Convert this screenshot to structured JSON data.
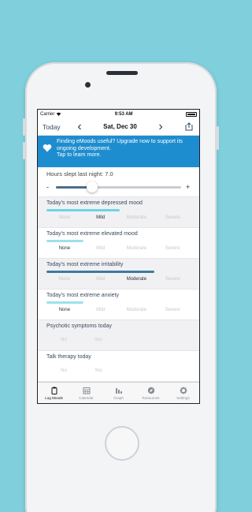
{
  "status": {
    "carrier": "Carrier",
    "time": "9:53 AM"
  },
  "nav": {
    "today": "Today",
    "prev": "‹",
    "next": "›",
    "date": "Sat, Dec 30"
  },
  "banner": {
    "line1": "Finding eMoods useful? Upgrade now to support its",
    "line2": "ongoing development.",
    "line3": "Tap to learn more."
  },
  "hours": {
    "label": "Hours slept last night: 7.0",
    "minus": "-",
    "plus": "+",
    "value": 7.0,
    "max": 24
  },
  "moods": [
    {
      "label": "Today's most extreme depressed mood",
      "levels": [
        "None",
        "Mild",
        "Moderate",
        "Severe"
      ],
      "selected": 1,
      "bar_color": "#6ed3e6",
      "bar_fraction": 0.68
    },
    {
      "label": "Today's most extreme elevated mood",
      "levels": [
        "None",
        "Mild",
        "Moderate",
        "Severe"
      ],
      "selected": 0,
      "bar_color": "#9fe0ec",
      "bar_fraction": 0.34
    },
    {
      "label": "Today's most extreme irritability",
      "levels": [
        "None",
        "Mild",
        "Moderate",
        "Severe"
      ],
      "selected": 2,
      "bar_color": "#3a7ca0",
      "bar_fraction": 1.0
    },
    {
      "label": "Today's most extreme anxiety",
      "levels": [
        "None",
        "Mild",
        "Moderate",
        "Severe"
      ],
      "selected": 0,
      "bar_color": "#9fe0ec",
      "bar_fraction": 0.34
    }
  ],
  "psychotic": {
    "label": "Psychotic symptoms today",
    "no": "No",
    "yes": "Yes"
  },
  "therapy": {
    "label": "Talk therapy today",
    "no": "No",
    "yes": "Yes"
  },
  "tabs": [
    {
      "label": "Log Moods",
      "icon": "clipboard-icon"
    },
    {
      "label": "Calendar",
      "icon": "calendar-icon"
    },
    {
      "label": "Graph",
      "icon": "bar-chart-icon"
    },
    {
      "label": "Resources",
      "icon": "compass-icon"
    },
    {
      "label": "Settings",
      "icon": "gear-icon"
    }
  ],
  "colors": {
    "background": "#7fcfdc",
    "banner": "#1e8dd0",
    "slider_fill": "#4b6e8a"
  }
}
